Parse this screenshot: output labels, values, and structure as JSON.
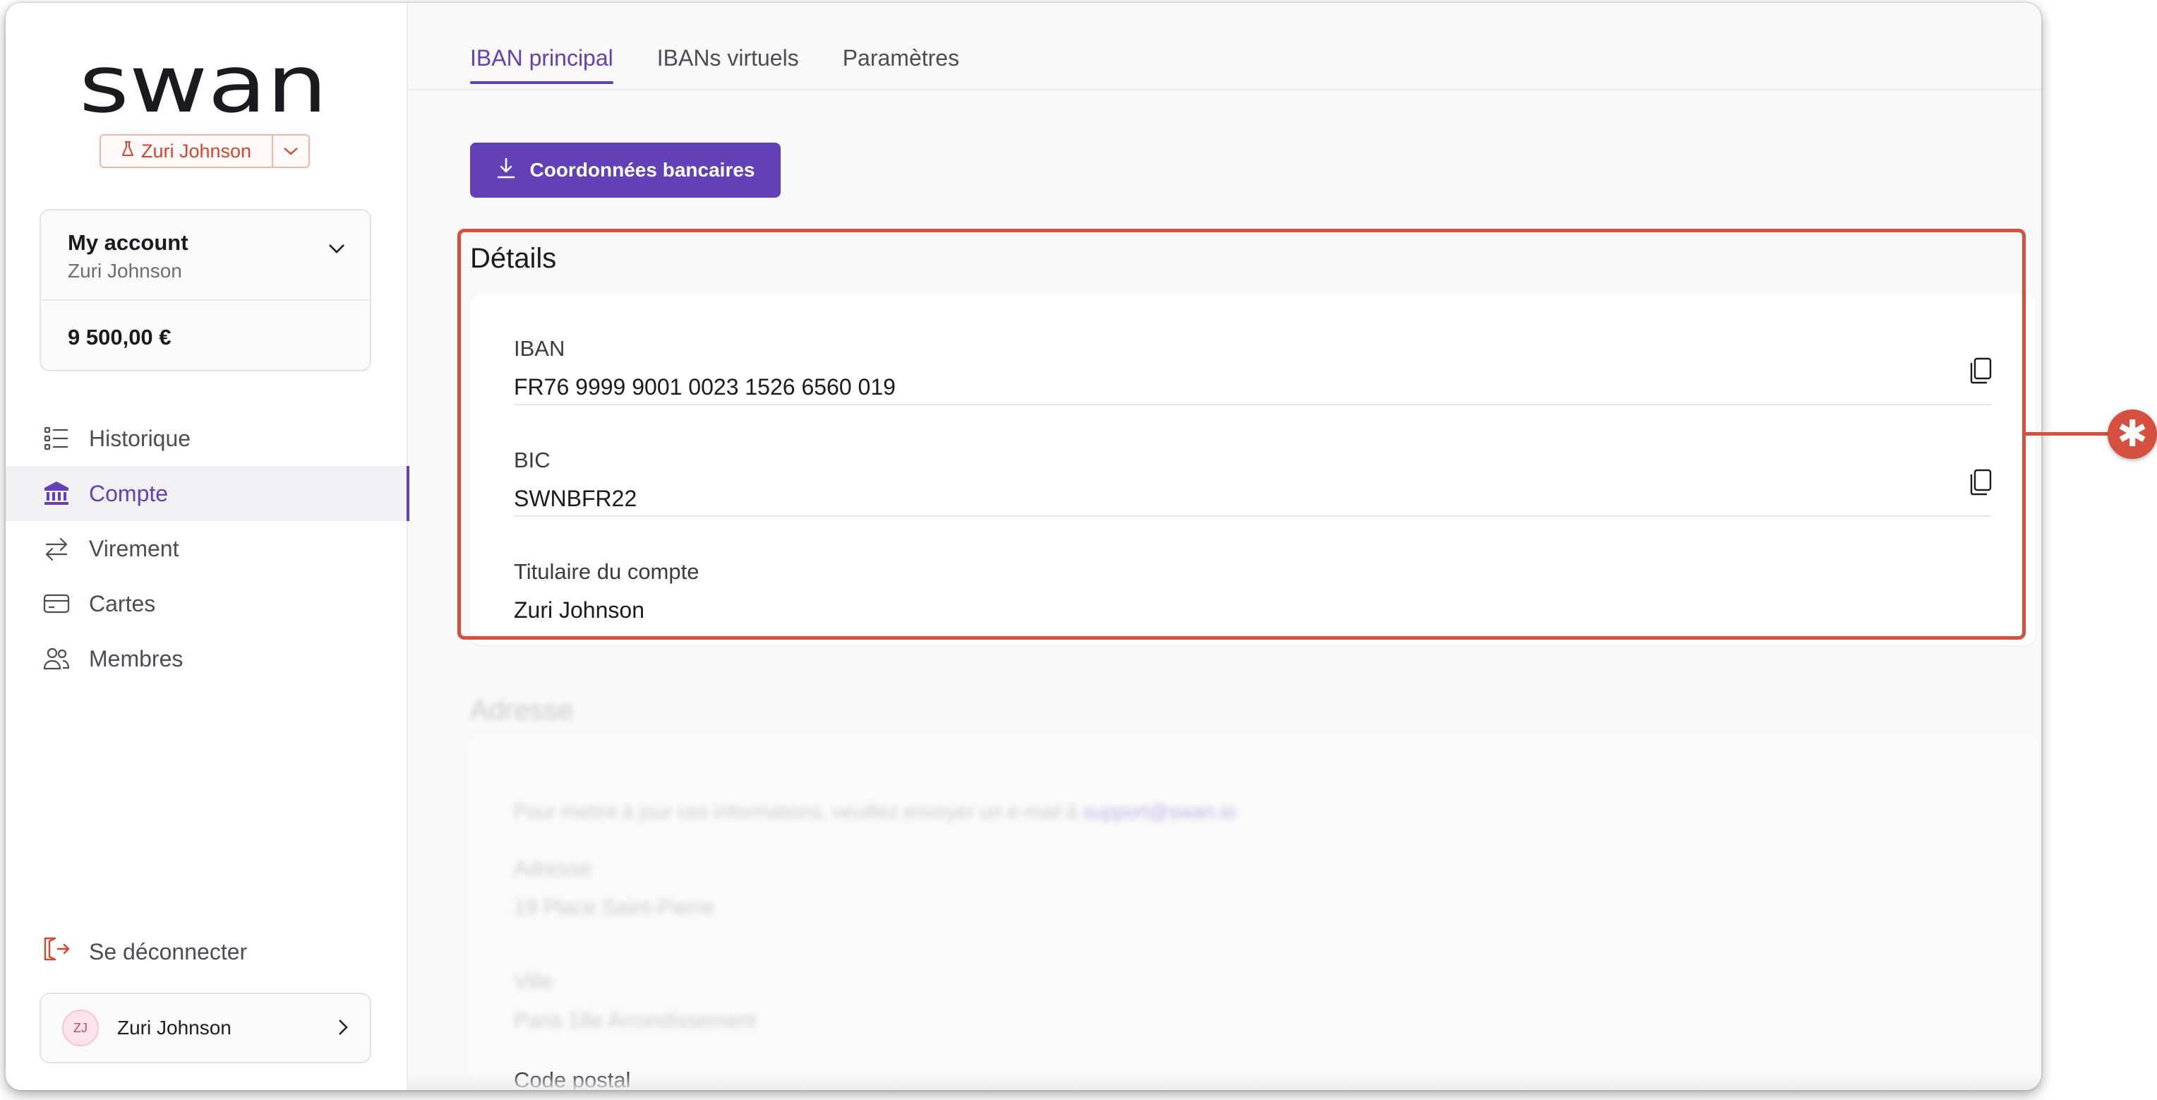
{
  "brand": {
    "logo_text": "swan",
    "accent": "#6240b5",
    "highlight": "#d6503f"
  },
  "project": {
    "name": "Zuri Johnson",
    "icon": "flask-icon"
  },
  "account": {
    "name": "My account",
    "holder": "Zuri Johnson",
    "balance": "9 500,00 €"
  },
  "nav": {
    "items": [
      {
        "label": "Historique",
        "icon": "list-icon"
      },
      {
        "label": "Compte",
        "icon": "bank-icon",
        "active": true
      },
      {
        "label": "Virement",
        "icon": "transfer-icon"
      },
      {
        "label": "Cartes",
        "icon": "card-icon"
      },
      {
        "label": "Membres",
        "icon": "members-icon"
      }
    ],
    "logout": "Se déconnecter"
  },
  "user": {
    "initials": "ZJ",
    "name": "Zuri Johnson"
  },
  "tabs": [
    {
      "label": "IBAN principal",
      "active": true
    },
    {
      "label": "IBANs virtuels"
    },
    {
      "label": "Paramètres"
    }
  ],
  "download_button": "Coordonnées bancaires",
  "details": {
    "title": "Détails",
    "fields": [
      {
        "label": "IBAN",
        "value": "FR76 9999 9001 0023 1526 6560 019"
      },
      {
        "label": "BIC",
        "value": "SWNBFR22"
      },
      {
        "label": "Titulaire du compte",
        "value": "Zuri Johnson"
      }
    ]
  },
  "address": {
    "title": "Adresse",
    "info": "Pour mettre à jour ces informations, veuillez envoyer un e-mail à",
    "email": "support@swan.io",
    "fields": [
      {
        "label": "Adresse",
        "value": "19 Place Saint-Pierre"
      },
      {
        "label": "Ville",
        "value": "Paris 18e Arrondissement"
      },
      {
        "label": "Code postal"
      }
    ]
  },
  "annotation": {
    "marker": "✱"
  }
}
